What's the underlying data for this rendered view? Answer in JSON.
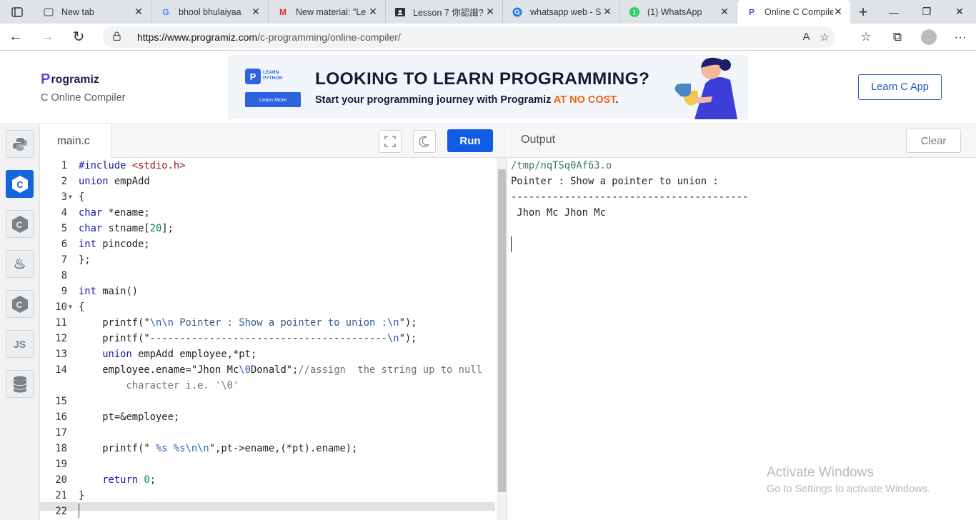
{
  "browser": {
    "tabs": [
      {
        "title": "New tab",
        "icon": "newtab-icon",
        "active": false
      },
      {
        "title": "bhool bhulaiyaa",
        "icon": "google-icon",
        "active": false
      },
      {
        "title": "New material: \"Le",
        "icon": "gmail-icon",
        "active": false
      },
      {
        "title": "Lesson 7 你認識?",
        "icon": "classroom-icon",
        "active": false
      },
      {
        "title": "whatsapp web - S",
        "icon": "search-icon",
        "active": false
      },
      {
        "title": "(1) WhatsApp",
        "icon": "whatsapp-icon",
        "active": false
      },
      {
        "title": "Online C Compile",
        "icon": "programiz-icon",
        "active": true
      }
    ],
    "url_host": "https://www.programiz.com",
    "url_path": "/c-programming/online-compiler/"
  },
  "header": {
    "logo_text": "rogramiz",
    "logo_mark": "P",
    "subtitle": "C Online Compiler",
    "learn_button": "Learn C App"
  },
  "banner": {
    "card_label": "LEARN PYTHON",
    "card_button": "Learn More",
    "title": "LOOKING TO LEARN PROGRAMMING?",
    "sub_before": "Start your programming journey with Programiz ",
    "sub_highlight": "AT NO COST",
    "sub_after": "."
  },
  "languages": [
    {
      "name": "python",
      "label": "",
      "active": false
    },
    {
      "name": "c",
      "label": "C",
      "active": true
    },
    {
      "name": "cpp",
      "label": "C",
      "active": false
    },
    {
      "name": "java",
      "label": "♨",
      "active": false
    },
    {
      "name": "csharp",
      "label": "C",
      "active": false
    },
    {
      "name": "javascript",
      "label": "JS",
      "active": false
    },
    {
      "name": "sql",
      "label": "",
      "active": false
    }
  ],
  "editor": {
    "filename": "main.c",
    "run_label": "Run"
  },
  "code": [
    {
      "n": "1",
      "fold": false
    },
    {
      "n": "2",
      "fold": false
    },
    {
      "n": "3",
      "fold": true
    },
    {
      "n": "4",
      "fold": false
    },
    {
      "n": "5",
      "fold": false
    },
    {
      "n": "6",
      "fold": false
    },
    {
      "n": "7",
      "fold": false
    },
    {
      "n": "8",
      "fold": false
    },
    {
      "n": "9",
      "fold": false
    },
    {
      "n": "10",
      "fold": true
    },
    {
      "n": "11",
      "fold": false
    },
    {
      "n": "12",
      "fold": false
    },
    {
      "n": "13",
      "fold": false
    },
    {
      "n": "14",
      "fold": false
    },
    {
      "n": "15",
      "fold": false
    },
    {
      "n": "16",
      "fold": false
    },
    {
      "n": "17",
      "fold": false
    },
    {
      "n": "18",
      "fold": false
    },
    {
      "n": "19",
      "fold": false
    },
    {
      "n": "20",
      "fold": false
    },
    {
      "n": "21",
      "fold": false
    },
    {
      "n": "22",
      "fold": false
    }
  ],
  "code_text": {
    "l1_kw": "#include",
    "l1_str": " <stdio.h>",
    "l2_kw": "union",
    "l2_rest": " empAdd",
    "l3": "{",
    "l4_kw": "char",
    "l4_rest": " *ename;",
    "l5_kw": "char",
    "l5_rest": " stname[",
    "l5_num": "20",
    "l5_end": "];",
    "l6_kw": "int",
    "l6_rest": " pincode;",
    "l7": "};",
    "l9_kw": "int",
    "l9_rest": " main()",
    "l10": "{",
    "l11_a": "    printf(\"",
    "l11_esc1": "\\n\\n",
    "l11_b": " Pointer : Show a pointer to union :",
    "l11_esc2": "\\n",
    "l11_c": "\");",
    "l12_a": "    printf(\"----------------------------------------",
    "l12_esc": "\\n",
    "l12_c": "\");",
    "l13_kw": "    union",
    "l13_rest": " empAdd employee,*pt;",
    "l14_a": "    employee.ename=\"Jhon Mc",
    "l14_esc": "\\0",
    "l14_b": "Donald\";",
    "l14_cmt": "//assign  the string up to null",
    "l14_wrap": "        character i.e. '\\0'",
    "l16": "    pt=&employee;",
    "l18_a": "    printf(\" ",
    "l18_esc": "%s %s\\n\\n",
    "l18_b": "\",pt->ename,(*pt).ename);",
    "l20_kw": "    return",
    "l20_num": " 0",
    "l20_end": ";",
    "l21": "}"
  },
  "output": {
    "title": "Output",
    "clear_label": "Clear",
    "lines": [
      "/tmp/nqTSq0Af63.o",
      "Pointer : Show a pointer to union :",
      "----------------------------------------",
      " Jhon Mc Jhon Mc"
    ]
  },
  "watermark": {
    "line1": "Activate Windows",
    "line2": "Go to Settings to activate Windows."
  }
}
